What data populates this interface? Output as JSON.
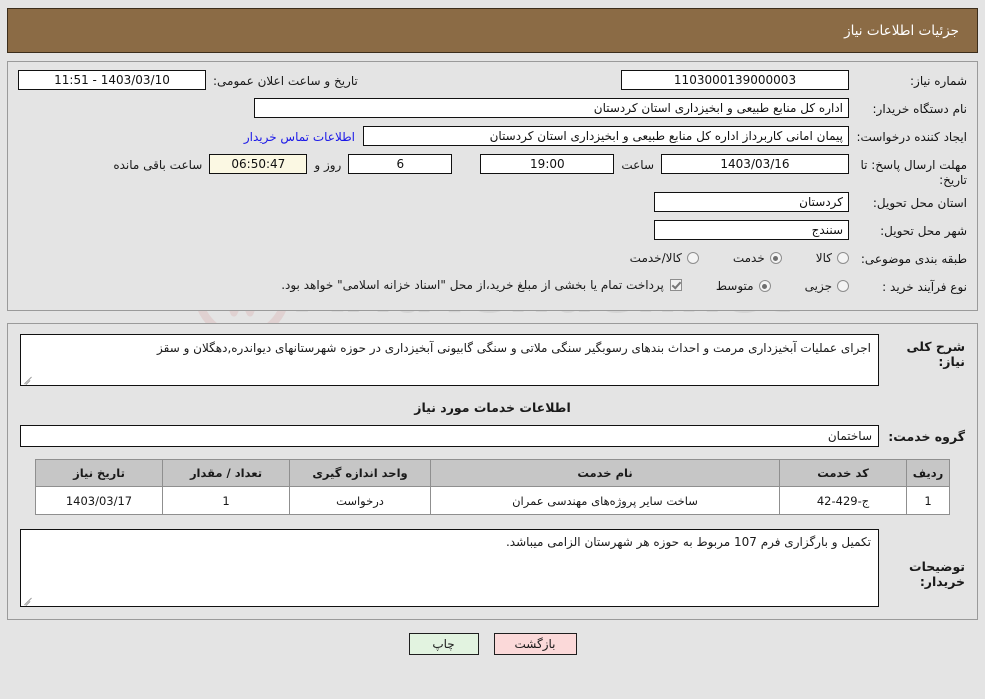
{
  "header": {
    "title": "جزئیات اطلاعات نیاز"
  },
  "form": {
    "need_number_label": "شماره نیاز:",
    "need_number_value": "1103000139000003",
    "announce_label": "تاریخ و ساعت اعلان عمومی:",
    "announce_value": "1403/03/10 - 11:51",
    "buyer_org_label": "نام دستگاه خریدار:",
    "buyer_org_value": "اداره کل منابع طبیعی و ابخیزداری استان کردستان",
    "creator_label": "ایجاد کننده درخواست:",
    "creator_value": "پیمان امانی کاربرداز اداره کل منابع طبیعی و ابخیزداری استان کردستان",
    "contact_link": "اطلاعات تماس خریدار",
    "deadline_label": "مهلت ارسال پاسخ: تا تاریخ:",
    "deadline_date": "1403/03/16",
    "hour_label": "ساعت",
    "hour_value": "19:00",
    "days_value": "6",
    "days_label": "روز و",
    "remaining_value": "06:50:47",
    "remaining_label": "ساعت باقی مانده",
    "province_label": "استان محل تحویل:",
    "province_value": "کردستان",
    "city_label": "شهر محل تحویل:",
    "city_value": "سنندج",
    "category_label": "طبقه بندی موضوعی:",
    "category_options": [
      {
        "label": "کالا",
        "selected": false
      },
      {
        "label": "خدمت",
        "selected": true
      },
      {
        "label": "کالا/خدمت",
        "selected": false
      }
    ],
    "process_label": "نوع فرآیند خرید :",
    "process_options": [
      {
        "label": "جزیی",
        "selected": false
      },
      {
        "label": "متوسط",
        "selected": true
      }
    ],
    "treasury_checked": true,
    "treasury_text": "پرداخت تمام یا بخشی از مبلغ خرید،از محل \"اسناد خزانه اسلامی\" خواهد بود."
  },
  "description": {
    "label": "شرح کلی نیاز:",
    "value": "اجرای عملیات آبخیزداری مرمت و احداث بندهای رسوبگیر سنگی ملاتی و سنگی گابیونی  آبخیزداری در حوزه شهرستانهای دیواندره,دهگلان و سقز"
  },
  "services": {
    "section_title": "اطلاعات خدمات مورد نیاز",
    "group_label": "گروه خدمت:",
    "group_value": "ساختمان",
    "columns": [
      "ردیف",
      "کد خدمت",
      "نام خدمت",
      "واحد اندازه گیری",
      "تعداد / مقدار",
      "تاریخ نیاز"
    ],
    "rows": [
      {
        "radif": "1",
        "code": "ج-429-42",
        "name": "ساخت سایر پروژه‌های مهندسی عمران",
        "unit": "درخواست",
        "qty": "1",
        "date": "1403/03/17"
      }
    ]
  },
  "notes": {
    "label": "توضیحات خریدار:",
    "value": "تکمیل و بارگزاری فرم 107 مربوط به حوزه هر شهرستان الزامی میباشد."
  },
  "footer": {
    "print_label": "چاپ",
    "back_label": "بازگشت"
  },
  "watermark": {
    "text": "AriaTender.net"
  },
  "colors": {
    "header_bg": "#8b6b45",
    "link": "#1b18e8",
    "print_btn": "#e2f3e0",
    "back_btn": "#fbd9d9",
    "table_header": "#c6c6c6"
  }
}
